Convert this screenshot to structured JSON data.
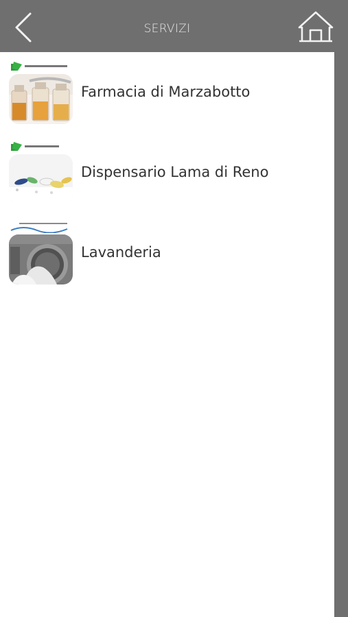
{
  "header": {
    "title": "SERVIZI",
    "back_icon": "chevron-left-icon",
    "home_icon": "home-icon",
    "background_color": "#6f6f6f"
  },
  "services": [
    {
      "label": "Farmacia di Marzabotto",
      "thumbnail": "pharmacy-bottles-image"
    },
    {
      "label": "Dispensario Lama di Reno",
      "thumbnail": "pills-image"
    },
    {
      "label": "Lavanderia",
      "thumbnail": "washing-machine-image"
    }
  ]
}
